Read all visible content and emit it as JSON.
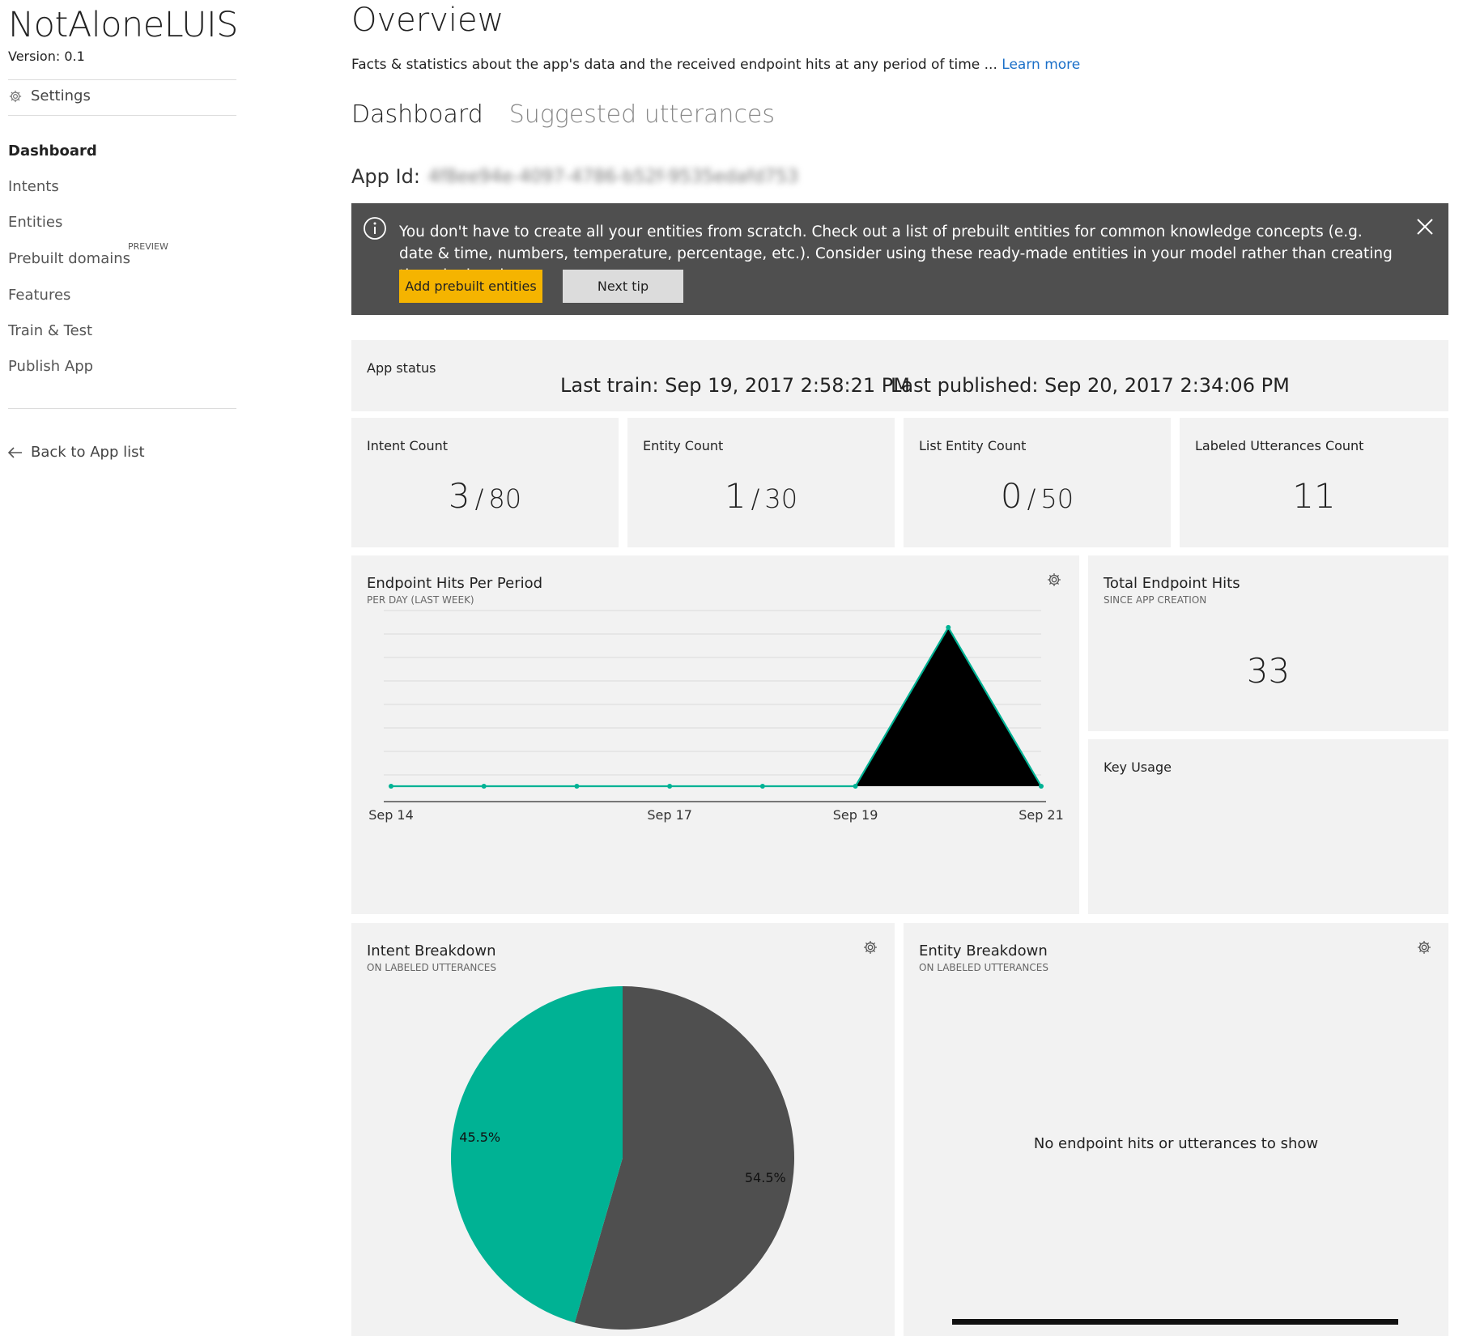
{
  "sidebar": {
    "app_name": "NotAloneLUIS",
    "version": "Version:  0.1",
    "settings_label": "Settings",
    "nav": [
      {
        "label": "Dashboard",
        "active": true
      },
      {
        "label": "Intents"
      },
      {
        "label": "Entities"
      },
      {
        "label": "Prebuilt domains",
        "tag": "PREVIEW"
      },
      {
        "label": "Features"
      },
      {
        "label": "Train & Test"
      },
      {
        "label": "Publish App"
      }
    ],
    "back_label": "Back to App list"
  },
  "header": {
    "title": "Overview",
    "subtitle": "Facts & statistics about the app's data and the received endpoint hits at any period of time ...",
    "learn_more": "Learn more",
    "tabs": [
      {
        "label": "Dashboard",
        "active": true
      },
      {
        "label": "Suggested utterances"
      }
    ],
    "app_id_label": "App Id:",
    "app_id_value": "4f8ee94e-4097-4786-b52f-9535edafd753"
  },
  "tip": {
    "text": "You don't have to create all your entities from scratch. Check out a list of prebuilt entities for common knowledge concepts (e.g. date & time, numbers, temperature, percentage, etc.). Consider using these ready-made entities in your model rather than creating them by hand.",
    "primary_button": "Add prebuilt entities",
    "secondary_button": "Next tip"
  },
  "app_status": {
    "label": "App status",
    "last_train_label": "Last train:",
    "last_train_value": "Sep 19, 2017 2:58:21 PM",
    "last_published_label": "Last published:",
    "last_published_value": "Sep 20, 2017 2:34:06 PM"
  },
  "counts": {
    "intent": {
      "label": "Intent Count",
      "value": "3",
      "max": "80"
    },
    "entity": {
      "label": "Entity Count",
      "value": "1",
      "max": "30"
    },
    "list_entity": {
      "label": "List Entity Count",
      "value": "0",
      "max": "50"
    },
    "labeled_utterances": {
      "label": "Labeled Utterances Count",
      "value": "11"
    }
  },
  "endpoint_hits": {
    "title": "Endpoint Hits Per Period",
    "subtitle": "PER DAY (LAST WEEK)"
  },
  "total_hits": {
    "title": "Total Endpoint Hits",
    "subtitle": "SINCE APP CREATION",
    "value": "33"
  },
  "key_usage": {
    "title": "Key Usage"
  },
  "intent_breakdown": {
    "title": "Intent Breakdown",
    "subtitle": "ON LABELED UTTERANCES"
  },
  "entity_breakdown": {
    "title": "Entity Breakdown",
    "subtitle": "ON LABELED UTTERANCES",
    "empty_message": "No endpoint hits or utterances to show"
  },
  "colors": {
    "accent_teal": "#00b294",
    "dark_slice": "#4f4f4f",
    "banner_bg": "#4f4f4f",
    "button_yellow": "#f5b400",
    "link_blue": "#1a6fc8",
    "card_bg": "#f2f2f2"
  },
  "chart_data": [
    {
      "type": "line",
      "x": [
        "Sep 14",
        "Sep 15",
        "Sep 16",
        "Sep 17",
        "Sep 18",
        "Sep 19",
        "Sep 20",
        "Sep 21"
      ],
      "values": [
        0,
        0,
        0,
        0,
        0,
        0,
        33,
        0
      ],
      "x_tick_labels": [
        "Sep 14",
        "Sep 17",
        "Sep 19",
        "Sep 21"
      ],
      "grid": true,
      "ylim": [
        0,
        35
      ]
    },
    {
      "type": "pie",
      "slices": [
        {
          "value": 54.5,
          "label": "54.5%",
          "color": "#4f4f4f"
        },
        {
          "value": 45.5,
          "label": "45.5%",
          "color": "#00b294"
        }
      ]
    }
  ]
}
